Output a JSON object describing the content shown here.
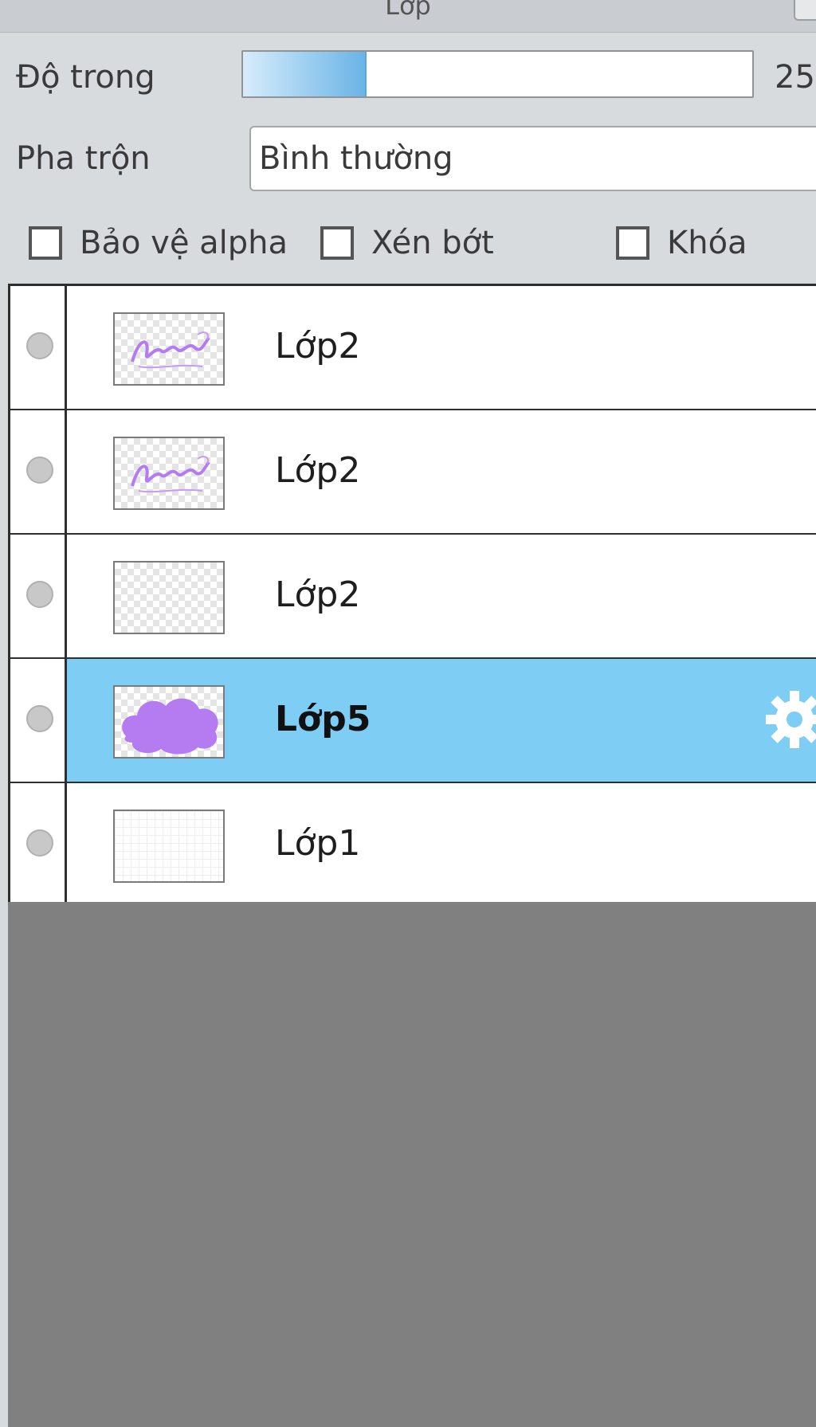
{
  "panel": {
    "title": "Lớp"
  },
  "opacity": {
    "label": "Độ trong",
    "value": "25",
    "fill_fraction": 0.24
  },
  "blend": {
    "label": "Pha trộn",
    "value": "Bình thường"
  },
  "options": {
    "protect_alpha": "Bảo vệ alpha",
    "clip": "Xén bớt",
    "lock": "Khóa"
  },
  "layers": [
    {
      "name": "Lớp2",
      "thumbnail": "purple-text-sketch",
      "selected": false
    },
    {
      "name": "Lớp2",
      "thumbnail": "purple-text-sketch",
      "selected": false
    },
    {
      "name": "Lớp2",
      "thumbnail": "transparent",
      "selected": false
    },
    {
      "name": "Lớp5",
      "thumbnail": "purple-cloud",
      "selected": true
    },
    {
      "name": "Lớp1",
      "thumbnail": "white-grid",
      "selected": false
    }
  ],
  "colors": {
    "selected_row": "#7ecdf4",
    "empty_area": "#808080",
    "thumbnail_accent": "#b47cf0"
  }
}
